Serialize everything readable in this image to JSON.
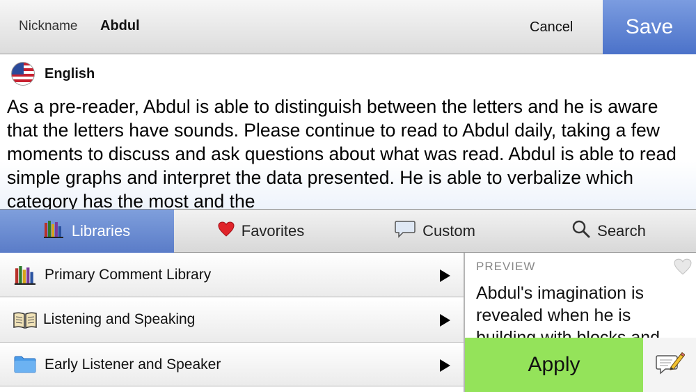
{
  "header": {
    "nickname_label": "Nickname",
    "nickname_value": "Abdul",
    "cancel_label": "Cancel",
    "save_label": "Save"
  },
  "language": {
    "label": "English",
    "flag_icon": "us-flag-icon"
  },
  "comment": {
    "text": "As a pre-reader, Abdul is able to distinguish between the letters and he is aware that the letters have sounds.  Please continue to read to Abdul daily, taking a few moments to discuss and ask questions about what was read.  Abdul is able to read simple graphs and interpret the data presented.  He is able to verbalize which category has the most and the"
  },
  "tabs": [
    {
      "label": "Libraries",
      "icon": "books-icon",
      "active": true
    },
    {
      "label": "Favorites",
      "icon": "heart-icon",
      "active": false
    },
    {
      "label": "Custom",
      "icon": "speech-bubble-icon",
      "active": false
    },
    {
      "label": "Search",
      "icon": "search-icon",
      "active": false
    }
  ],
  "libraries": [
    {
      "label": "Primary Comment Library",
      "icon": "books-icon"
    },
    {
      "label": "Listening and Speaking",
      "icon": "open-book-icon"
    },
    {
      "label": "Early Listener and Speaker",
      "icon": "folder-icon"
    }
  ],
  "preview": {
    "title": "PREVIEW",
    "text": "Abdul's imagination is revealed when he is building with blocks and",
    "apply_label": "Apply"
  },
  "colors": {
    "save_blue": "#4b72c9",
    "tab_active": "#5a7cc8",
    "apply_green": "#94e35a"
  }
}
